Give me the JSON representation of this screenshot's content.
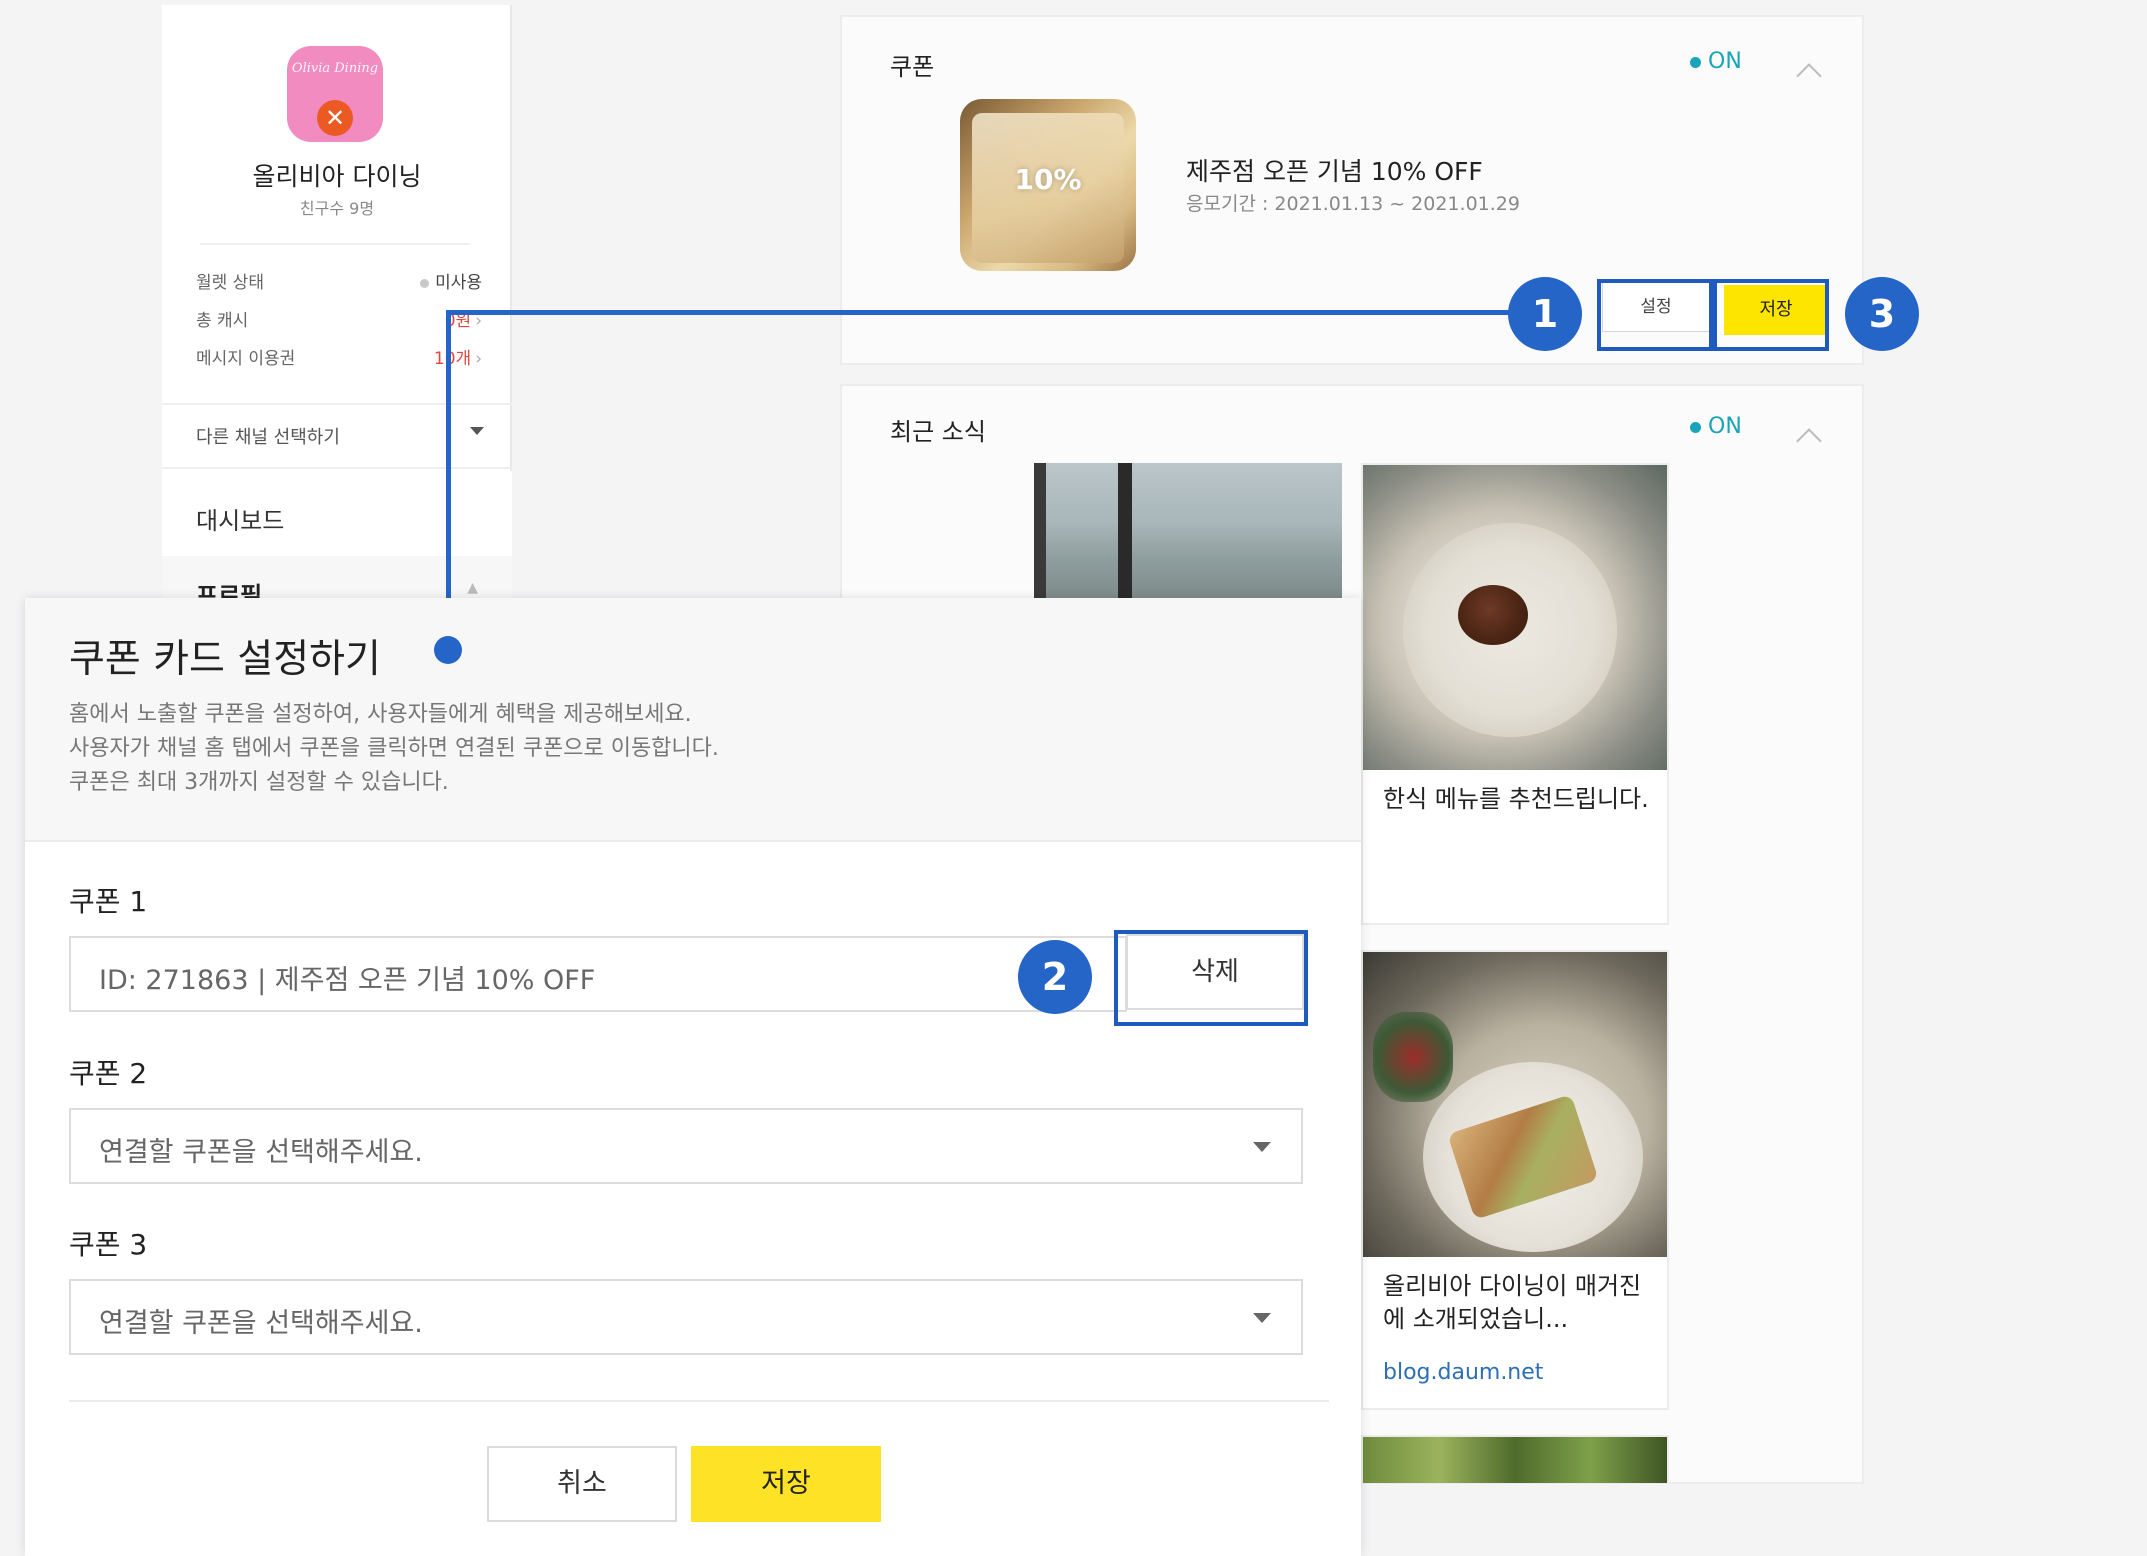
{
  "sidebar": {
    "logo_text": "Olivia Dining",
    "channel_name": "올리비아 다이닝",
    "friends": "친구수 9명",
    "stats": [
      {
        "label": "월렛 상태",
        "value": "미사용"
      },
      {
        "label": "총 캐시",
        "value": "0원"
      },
      {
        "label": "메시지 이용권",
        "value": "10개"
      }
    ],
    "channel_select": "다른 채널 선택하기",
    "menu_dashboard": "대시보드",
    "menu_profile": "프로필"
  },
  "coupon_panel": {
    "title": "쿠폰",
    "status": "ON",
    "thumb_label": "10%",
    "coupon_title": "제주점 오픈 기념 10% OFF",
    "coupon_period": "응모기간 : 2021.01.13 ~ 2021.01.29",
    "setting_button": "설정",
    "save_button": "저장"
  },
  "news_panel": {
    "title": "최근 소식",
    "status": "ON",
    "cards": [
      {
        "text": "한식 메뉴를 추천드립니다."
      },
      {
        "text": "올리비아 다이닝이 매거진에 소개되었습니...",
        "link": "blog.daum.net"
      }
    ]
  },
  "callouts": [
    "1",
    "2",
    "3"
  ],
  "modal": {
    "title": "쿠폰 카드 설정하기",
    "desc": [
      "홈에서 노출할 쿠폰을 설정하여, 사용자들에게 혜택을 제공해보세요.",
      "사용자가 채널 홈 탭에서 쿠폰을 클릭하면 연결된 쿠폰으로 이동합니다.",
      "쿠폰은 최대 3개까지 설정할 수 있습니다."
    ],
    "coupons": [
      {
        "label": "쿠폰 1",
        "value": "ID: 271863 | 제주점 오픈 기념 10% OFF"
      },
      {
        "label": "쿠폰 2",
        "placeholder": "연결할 쿠폰을 선택해주세요."
      },
      {
        "label": "쿠폰 3",
        "placeholder": "연결할 쿠폰을 선택해주세요."
      }
    ],
    "delete_button": "삭제",
    "cancel_button": "취소",
    "save_button": "저장"
  },
  "colors": {
    "accent_yellow": "#fee500",
    "callout_blue": "#2565c7",
    "on_teal": "#19a5b9",
    "alert_red": "#e0483c"
  }
}
